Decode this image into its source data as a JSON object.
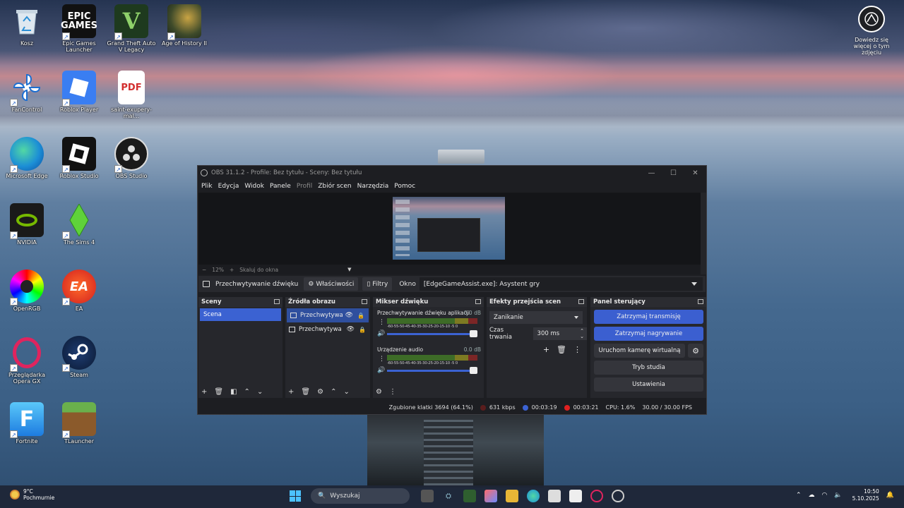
{
  "desktop": {
    "icons": [
      {
        "label": "Kosz",
        "icon": "recycle-bin-icon"
      },
      {
        "label": "Epic Games Launcher",
        "icon": "epic-games-icon"
      },
      {
        "label": "Grand Theft Auto V Legacy",
        "icon": "gta-icon"
      },
      {
        "label": "Age of History II",
        "icon": "age-of-history-icon"
      },
      {
        "label": "FanControl",
        "icon": "fancontrol-icon"
      },
      {
        "label": "Roblox Player",
        "icon": "roblox-player-icon"
      },
      {
        "label": "saint-exupery-mal...",
        "icon": "pdf-icon"
      },
      {
        "label": "Microsoft Edge",
        "icon": "edge-icon"
      },
      {
        "label": "Roblox Studio",
        "icon": "roblox-studio-icon"
      },
      {
        "label": "OBS Studio",
        "icon": "obs-icon"
      },
      {
        "label": "NVIDIA",
        "icon": "nvidia-icon"
      },
      {
        "label": "The Sims 4",
        "icon": "sims-icon"
      },
      {
        "label": "OpenRGB",
        "icon": "openrgb-icon"
      },
      {
        "label": "EA",
        "icon": "ea-icon"
      },
      {
        "label": "Przeglądarka Opera GX",
        "icon": "opera-gx-icon"
      },
      {
        "label": "Steam",
        "icon": "steam-icon"
      },
      {
        "label": "Fortnite",
        "icon": "fortnite-icon"
      },
      {
        "label": "TLauncher",
        "icon": "tlauncher-icon"
      }
    ],
    "tile_texts": {
      "epic": "EPIC\nGAMES",
      "pdf": "PDF",
      "gta": "V",
      "ea": "EA",
      "fortnite": "F"
    },
    "spotlight_label": "Dowiedz się więcej o tym zdjęciu"
  },
  "obs": {
    "title": "OBS 31.1.2 - Profile: Bez tytułu - Sceny: Bez tytułu",
    "window_controls": {
      "minimize": "—",
      "maximize": "☐",
      "close": "✕"
    },
    "menu": [
      "Plik",
      "Edycja",
      "Widok",
      "Panele",
      "Profil",
      "Zbiór scen",
      "Narzędzia",
      "Pomoc"
    ],
    "zoom": {
      "minus": "−",
      "value": "12%",
      "plus": "+",
      "fit": "Skaluj do okna"
    },
    "properties_bar": {
      "source_name": "Przechwytywanie dźwięku",
      "properties_btn": "⚙ Właściwości",
      "filters_btn": "▯ Filtry",
      "window_label": "Okno",
      "window_value": "[EdgeGameAssist.exe]: Asystent gry"
    },
    "scenes": {
      "title": "Sceny",
      "items": [
        "Scena"
      ]
    },
    "sources": {
      "title": "Źródła obrazu",
      "items": [
        "Przechwytywa",
        "Przechwytywa"
      ]
    },
    "mixer": {
      "title": "Mikser dźwięku",
      "scale": "-60-55-50-45-40-35-30-25-20-15-10 -5  0",
      "channels": [
        {
          "name": "Przechwytywanie dźwięku aplikacji",
          "db": "0.0 dB"
        },
        {
          "name": "Urządzenie audio",
          "db": "0.0 dB"
        }
      ]
    },
    "transitions": {
      "title": "Efekty przejścia scen",
      "selected": "Zanikanie",
      "duration_label": "Czas trwania",
      "duration_value": "300 ms"
    },
    "controls": {
      "title": "Panel sterujący",
      "stop_stream": "Zatrzymaj transmisję",
      "stop_record": "Zatrzymaj nagrywanie",
      "virtual_cam": "Uruchom kamerę wirtualną",
      "studio_mode": "Tryb studia",
      "settings": "Ustawienia"
    },
    "status": {
      "dropped": "Zgubione klatki 3694 (64.1%)",
      "bitrate": "631 kbps",
      "stream_time": "00:03:19",
      "rec_time": "00:03:21",
      "cpu": "CPU: 1.6%",
      "fps": "30.00 / 30.00 FPS"
    }
  },
  "taskbar": {
    "weather_temp": "9°C",
    "weather_desc": "Pochmurnie",
    "search_placeholder": "Wyszukaj",
    "time": "10:50",
    "date": "5.10.2025"
  }
}
